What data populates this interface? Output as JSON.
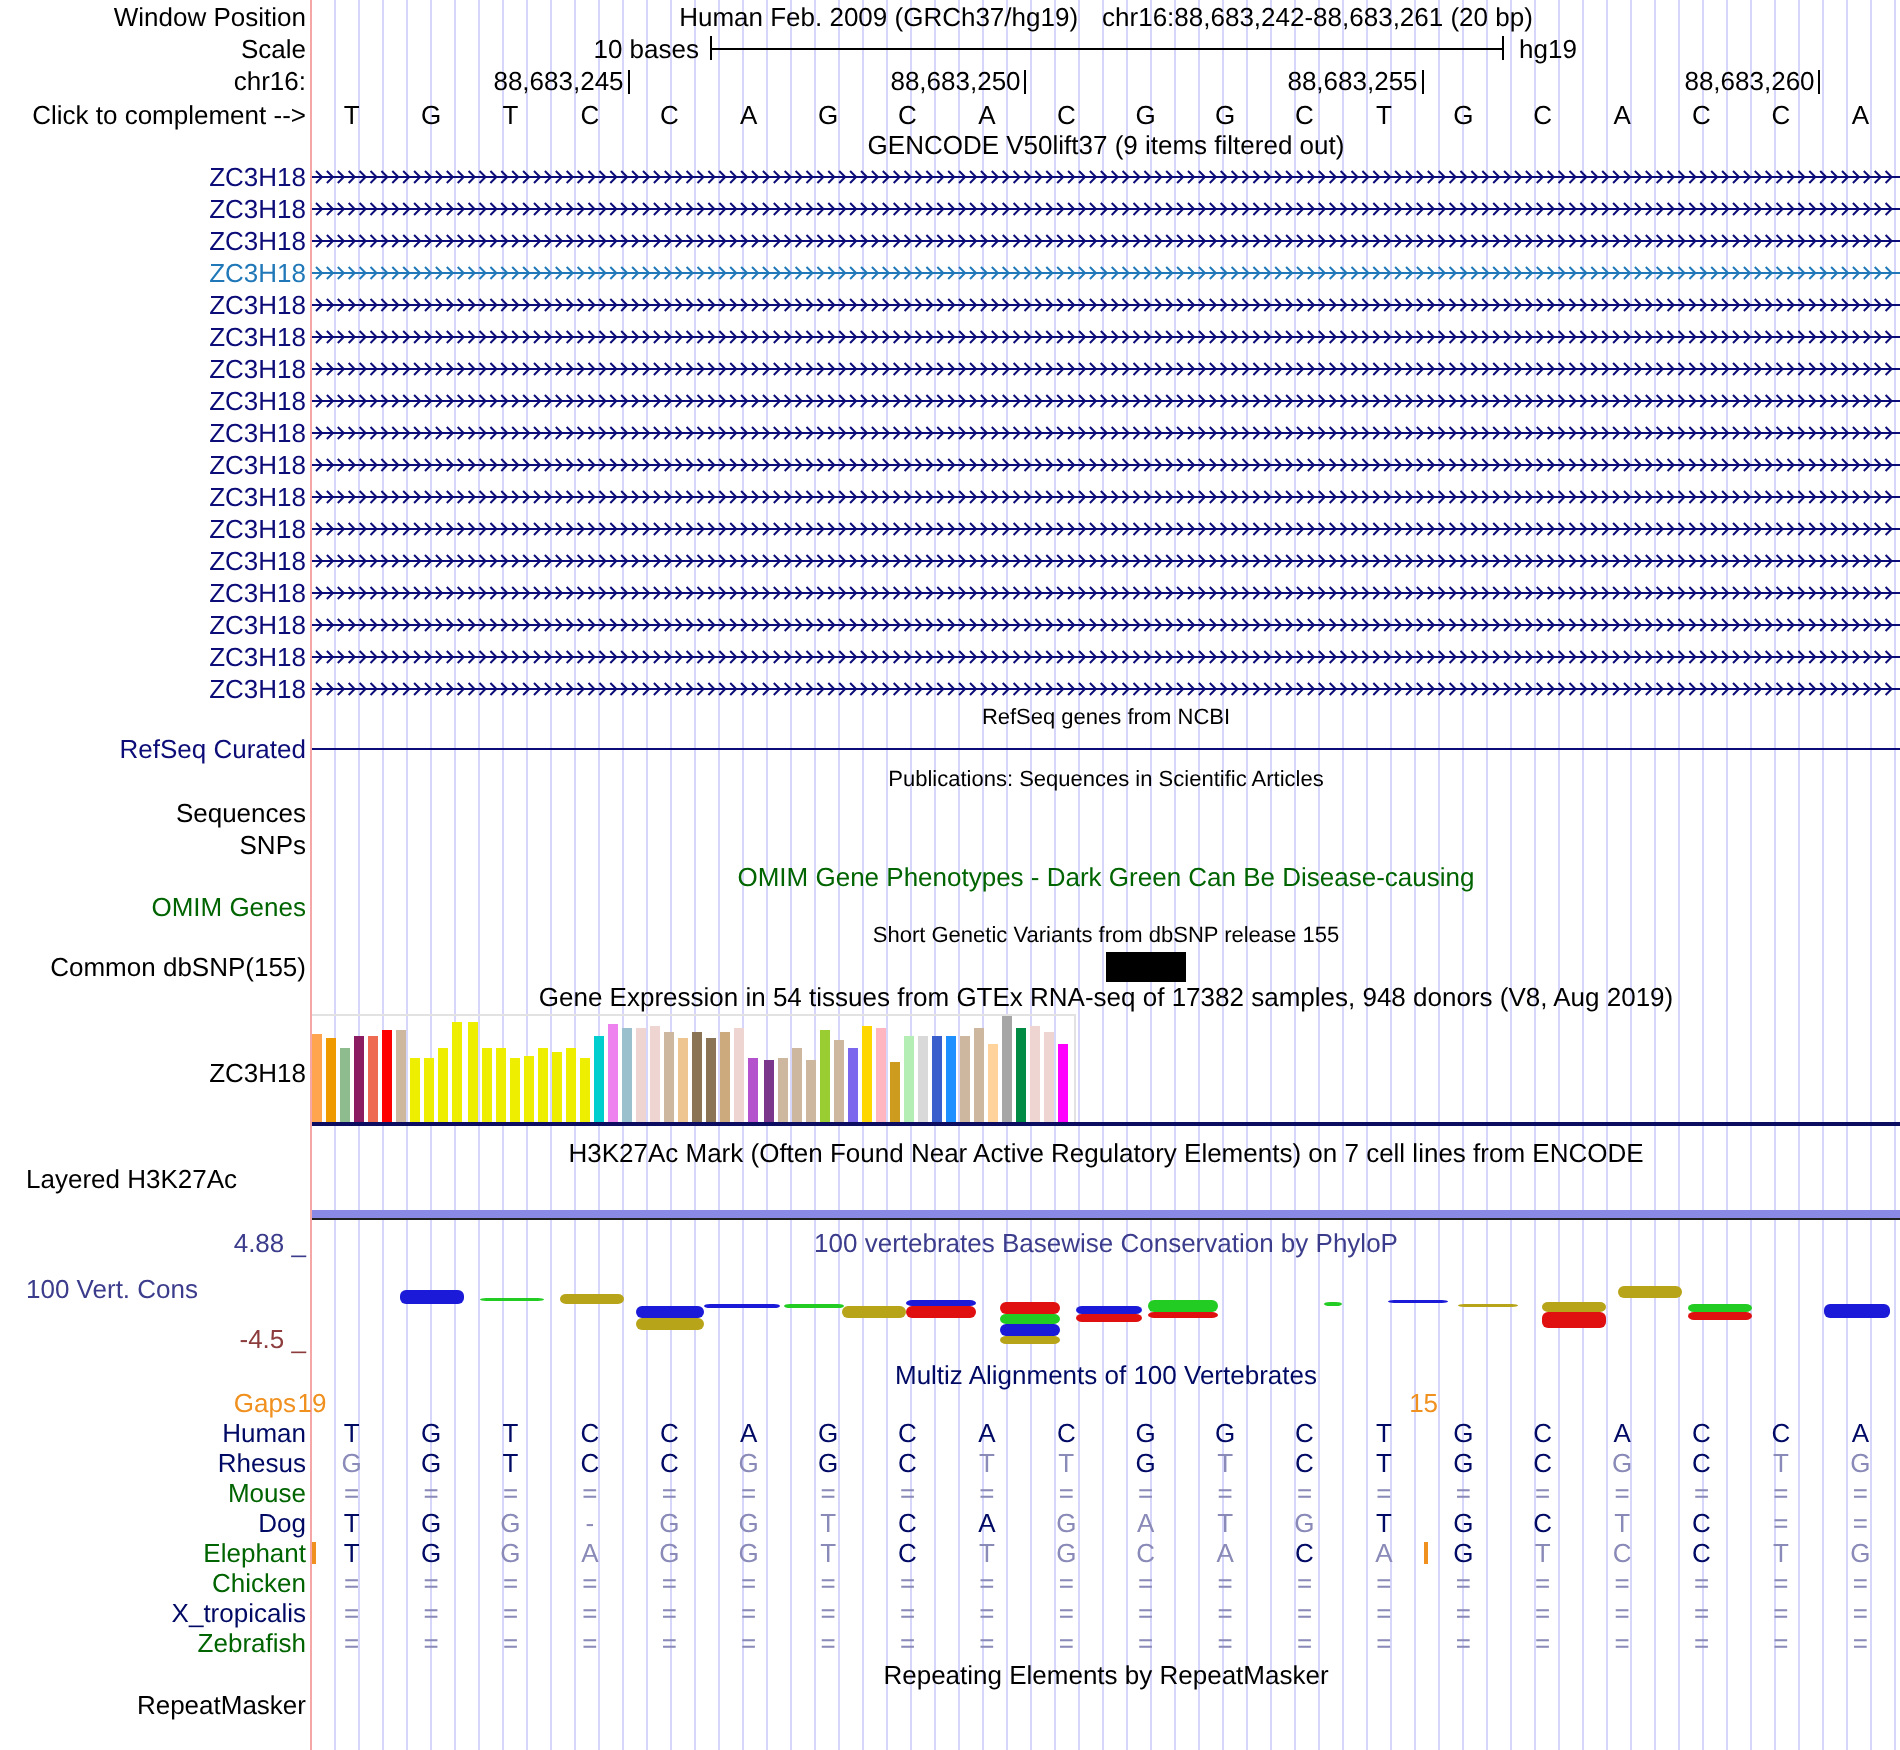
{
  "position": {
    "label": "Window Position",
    "assembly": "Human Feb. 2009 (GRCh37/hg19)",
    "region": "chr16:88,683,242-88,683,261 (20 bp)"
  },
  "scale": {
    "label": "Scale",
    "text": "10 bases",
    "assembly": "hg19"
  },
  "ruler": {
    "label": "chr16:",
    "ticks": [
      "88,683,245",
      "88,683,250",
      "88,683,255",
      "88,683,260"
    ]
  },
  "sequence": {
    "label": "Click to complement -->",
    "bases": [
      "T",
      "G",
      "T",
      "C",
      "C",
      "A",
      "G",
      "C",
      "A",
      "C",
      "G",
      "G",
      "C",
      "T",
      "G",
      "C",
      "A",
      "C",
      "C",
      "A"
    ]
  },
  "tracks": [
    {
      "kind": "genes",
      "title": "GENCODE V50lift37 (9 items filtered out)",
      "color": "#000000",
      "rows": [
        {
          "label": "ZC3H18",
          "color": "#0c0c78"
        },
        {
          "label": "ZC3H18",
          "color": "#0c0c78"
        },
        {
          "label": "ZC3H18",
          "color": "#0c0c78"
        },
        {
          "label": "ZC3H18",
          "color": "#2178b8"
        },
        {
          "label": "ZC3H18",
          "color": "#0c0c78"
        },
        {
          "label": "ZC3H18",
          "color": "#0c0c78"
        },
        {
          "label": "ZC3H18",
          "color": "#0c0c78"
        },
        {
          "label": "ZC3H18",
          "color": "#0c0c78"
        },
        {
          "label": "ZC3H18",
          "color": "#0c0c78"
        },
        {
          "label": "ZC3H18",
          "color": "#0c0c78"
        },
        {
          "label": "ZC3H18",
          "color": "#0c0c78"
        },
        {
          "label": "ZC3H18",
          "color": "#0c0c78"
        },
        {
          "label": "ZC3H18",
          "color": "#0c0c78"
        },
        {
          "label": "ZC3H18",
          "color": "#0c0c78"
        },
        {
          "label": "ZC3H18",
          "color": "#0c0c78"
        },
        {
          "label": "ZC3H18",
          "color": "#0c0c78"
        },
        {
          "label": "ZC3H18",
          "color": "#0c0c78"
        }
      ]
    },
    {
      "kind": "line",
      "title": "RefSeq genes from NCBI",
      "color": "#000000",
      "rows": [
        {
          "label": "RefSeq Curated",
          "color": "#0c0c78"
        }
      ]
    },
    {
      "kind": "labels",
      "title": "Publications: Sequences in Scientific Articles",
      "color": "#000000",
      "rows": [
        {
          "label": "Sequences",
          "color": "#000000"
        },
        {
          "label": "SNPs",
          "color": "#000000"
        }
      ]
    },
    {
      "kind": "empty",
      "title": "OMIM Gene Phenotypes - Dark Green Can Be Disease-causing",
      "color": "#006400",
      "rows": [
        {
          "label": "OMIM Genes",
          "color": "#006400"
        }
      ]
    },
    {
      "kind": "snp",
      "title": "Short Genetic Variants from dbSNP release 155",
      "color": "#000000",
      "rows": [
        {
          "label": "Common dbSNP(155)",
          "color": "#000000",
          "features": [
            {
              "kind": "none"
            },
            {
              "kind": "none"
            },
            {
              "kind": "none"
            },
            {
              "kind": "none"
            },
            {
              "kind": "none"
            },
            {
              "kind": "none"
            },
            {
              "kind": "none"
            },
            {
              "kind": "none"
            },
            {
              "kind": "none"
            },
            {
              "kind": "none"
            },
            {
              "kind": "variant"
            },
            {
              "kind": "none"
            },
            {
              "kind": "none"
            },
            {
              "kind": "none"
            },
            {
              "kind": "none"
            },
            {
              "kind": "none"
            },
            {
              "kind": "none"
            },
            {
              "kind": "none"
            },
            {
              "kind": "none"
            },
            {
              "kind": "none"
            }
          ]
        }
      ]
    },
    {
      "kind": "bars",
      "title": "Gene Expression in 54 tissues from GTEx RNA-seq of 17382 samples, 948 donors (V8, Aug 2019)",
      "color": "#000000",
      "rows": [
        {
          "label": "ZC3H18",
          "color": "#000000",
          "bars": [
            {
              "color": "#ffa54f"
            },
            {
              "color": "#ee9a00"
            },
            {
              "color": "#8fbc8f"
            },
            {
              "color": "#8b1c62"
            },
            {
              "color": "#ee6a50"
            },
            {
              "color": "#ff0000"
            },
            {
              "color": "#cdb79e"
            },
            {
              "color": "#eeee00"
            },
            {
              "color": "#eeee00"
            },
            {
              "color": "#eeee00"
            },
            {
              "color": "#eeee00"
            },
            {
              "color": "#eeee00"
            },
            {
              "color": "#eeee00"
            },
            {
              "color": "#eeee00"
            },
            {
              "color": "#eeee00"
            },
            {
              "color": "#eeee00"
            },
            {
              "color": "#eeee00"
            },
            {
              "color": "#eeee00"
            },
            {
              "color": "#eeee00"
            },
            {
              "color": "#eeee00"
            },
            {
              "color": "#00cdcd"
            },
            {
              "color": "#ee82ee"
            },
            {
              "color": "#9ac0cd"
            },
            {
              "color": "#eed5d2"
            },
            {
              "color": "#eed5d2"
            },
            {
              "color": "#cdb79e"
            },
            {
              "color": "#eec591"
            },
            {
              "color": "#8b7355"
            },
            {
              "color": "#8b7355"
            },
            {
              "color": "#cdaa7d"
            },
            {
              "color": "#eed5d2"
            },
            {
              "color": "#b452cd"
            },
            {
              "color": "#7a378b"
            },
            {
              "color": "#cdb79e"
            },
            {
              "color": "#cdb79e"
            },
            {
              "color": "#cdb79e"
            },
            {
              "color": "#9acd32"
            },
            {
              "color": "#cdb79e"
            },
            {
              "color": "#7a67ee"
            },
            {
              "color": "#ffd700"
            },
            {
              "color": "#ffb6c1"
            },
            {
              "color": "#cd9b1d"
            },
            {
              "color": "#b4eeb4"
            },
            {
              "color": "#d9d9d9"
            },
            {
              "color": "#3a5fcd"
            },
            {
              "color": "#1e90ff"
            },
            {
              "color": "#cdb79e"
            },
            {
              "color": "#cdb79e"
            },
            {
              "color": "#ffd39b"
            },
            {
              "color": "#a6a6a6"
            },
            {
              "color": "#008b45"
            },
            {
              "color": "#eed5d2"
            },
            {
              "color": "#eed5d2"
            },
            {
              "color": "#ff00ff"
            }
          ]
        }
      ]
    },
    {
      "kind": "signal",
      "title": "H3K27Ac Mark (Often Found Near Active Regulatory Elements) on 7 cell lines from ENCODE",
      "color": "#000000",
      "rows": [
        {
          "label": "Layered H3K27Ac",
          "color": "#000000"
        }
      ]
    },
    {
      "kind": "conservation",
      "title": "100 vertebrates Basewise Conservation by PhyloP",
      "color": "#3c3c8c",
      "scale_labels": [
        {
          "text": "4.88 _",
          "color": "#3c3c8c"
        },
        {
          "text": "-4.5 _",
          "color": "#8c3c3c"
        }
      ],
      "rows": [
        {
          "label": "100 Vert. Cons",
          "color": "#3c3c8c"
        }
      ]
    },
    {
      "kind": "alignment",
      "title": "Multiz Alignments of 100 Vertebrates",
      "color": "#000a64",
      "gaps": {
        "label": "Gaps",
        "color": "#f0901e"
      },
      "rows": [
        {
          "label": "Human",
          "color": "#000a64",
          "bases": [
            {
              "base": "T",
              "match": true
            },
            {
              "base": "G",
              "match": true
            },
            {
              "base": "T",
              "match": true
            },
            {
              "base": "C",
              "match": true
            },
            {
              "base": "C",
              "match": true
            },
            {
              "base": "A",
              "match": true
            },
            {
              "base": "G",
              "match": true
            },
            {
              "base": "C",
              "match": true
            },
            {
              "base": "A",
              "match": true
            },
            {
              "base": "C",
              "match": true
            },
            {
              "base": "G",
              "match": true
            },
            {
              "base": "G",
              "match": true
            },
            {
              "base": "C",
              "match": true
            },
            {
              "base": "T",
              "match": true
            },
            {
              "base": "G",
              "match": true
            },
            {
              "base": "C",
              "match": true
            },
            {
              "base": "A",
              "match": true
            },
            {
              "base": "C",
              "match": true
            },
            {
              "base": "C",
              "match": true
            },
            {
              "base": "A",
              "match": true
            }
          ]
        },
        {
          "label": "Rhesus",
          "color": "#000a64",
          "bases": [
            {
              "base": "G",
              "match": false
            },
            {
              "base": "G",
              "match": true
            },
            {
              "base": "T",
              "match": true
            },
            {
              "base": "C",
              "match": true
            },
            {
              "base": "C",
              "match": true
            },
            {
              "base": "G",
              "match": false
            },
            {
              "base": "G",
              "match": true
            },
            {
              "base": "C",
              "match": true
            },
            {
              "base": "T",
              "match": false
            },
            {
              "base": "T",
              "match": false
            },
            {
              "base": "G",
              "match": true
            },
            {
              "base": "T",
              "match": false
            },
            {
              "base": "C",
              "match": true
            },
            {
              "base": "T",
              "match": true
            },
            {
              "base": "G",
              "match": true
            },
            {
              "base": "C",
              "match": true
            },
            {
              "base": "G",
              "match": false
            },
            {
              "base": "C",
              "match": true
            },
            {
              "base": "T",
              "match": false
            },
            {
              "base": "G",
              "match": false
            }
          ]
        },
        {
          "label": "Mouse",
          "color": "#006400",
          "bases": [
            {
              "base": "=",
              "match": false
            },
            {
              "base": "=",
              "match": false
            },
            {
              "base": "=",
              "match": false
            },
            {
              "base": "=",
              "match": false
            },
            {
              "base": "=",
              "match": false
            },
            {
              "base": "=",
              "match": false
            },
            {
              "base": "=",
              "match": false
            },
            {
              "base": "=",
              "match": false
            },
            {
              "base": "=",
              "match": false
            },
            {
              "base": "=",
              "match": false
            },
            {
              "base": "=",
              "match": false
            },
            {
              "base": "=",
              "match": false
            },
            {
              "base": "=",
              "match": false
            },
            {
              "base": "=",
              "match": false
            },
            {
              "base": "=",
              "match": false
            },
            {
              "base": "=",
              "match": false
            },
            {
              "base": "=",
              "match": false
            },
            {
              "base": "=",
              "match": false
            },
            {
              "base": "=",
              "match": false
            },
            {
              "base": "=",
              "match": false
            }
          ]
        },
        {
          "label": "Dog",
          "color": "#000a64",
          "bases": [
            {
              "base": "T",
              "match": true
            },
            {
              "base": "G",
              "match": true
            },
            {
              "base": "G",
              "match": false
            },
            {
              "base": "-",
              "match": false
            },
            {
              "base": "G",
              "match": false
            },
            {
              "base": "G",
              "match": false
            },
            {
              "base": "T",
              "match": false
            },
            {
              "base": "C",
              "match": true
            },
            {
              "base": "A",
              "match": true
            },
            {
              "base": "G",
              "match": false
            },
            {
              "base": "A",
              "match": false
            },
            {
              "base": "T",
              "match": false
            },
            {
              "base": "G",
              "match": false
            },
            {
              "base": "T",
              "match": true
            },
            {
              "base": "G",
              "match": true
            },
            {
              "base": "C",
              "match": true
            },
            {
              "base": "T",
              "match": false
            },
            {
              "base": "C",
              "match": true
            },
            {
              "base": "=",
              "match": false
            },
            {
              "base": "=",
              "match": false
            }
          ]
        },
        {
          "label": "Elephant",
          "color": "#006400",
          "bases": [
            {
              "base": "T",
              "match": true,
              "insert": true,
              "gap_count": "19"
            },
            {
              "base": "G",
              "match": true,
              "insert": false
            },
            {
              "base": "G",
              "match": false,
              "insert": false
            },
            {
              "base": "A",
              "match": false,
              "insert": false
            },
            {
              "base": "G",
              "match": false,
              "insert": false
            },
            {
              "base": "G",
              "match": false,
              "insert": false
            },
            {
              "base": "T",
              "match": false,
              "insert": false
            },
            {
              "base": "C",
              "match": true,
              "insert": false
            },
            {
              "base": "T",
              "match": false,
              "insert": false
            },
            {
              "base": "G",
              "match": false,
              "insert": false
            },
            {
              "base": "C",
              "match": false,
              "insert": false
            },
            {
              "base": "A",
              "match": false,
              "insert": false
            },
            {
              "base": "C",
              "match": true,
              "insert": false
            },
            {
              "base": "A",
              "match": false,
              "insert": false
            },
            {
              "base": "G",
              "match": true,
              "insert": true,
              "gap_count": "15"
            },
            {
              "base": "T",
              "match": false,
              "insert": false
            },
            {
              "base": "C",
              "match": false,
              "insert": false
            },
            {
              "base": "C",
              "match": true,
              "insert": false
            },
            {
              "base": "T",
              "match": false,
              "insert": false
            },
            {
              "base": "G",
              "match": false,
              "insert": false
            }
          ]
        },
        {
          "label": "Chicken",
          "color": "#006400",
          "bases": [
            {
              "base": "=",
              "match": false
            },
            {
              "base": "=",
              "match": false
            },
            {
              "base": "=",
              "match": false
            },
            {
              "base": "=",
              "match": false
            },
            {
              "base": "=",
              "match": false
            },
            {
              "base": "=",
              "match": false
            },
            {
              "base": "=",
              "match": false
            },
            {
              "base": "=",
              "match": false
            },
            {
              "base": "=",
              "match": false
            },
            {
              "base": "=",
              "match": false
            },
            {
              "base": "=",
              "match": false
            },
            {
              "base": "=",
              "match": false
            },
            {
              "base": "=",
              "match": false
            },
            {
              "base": "=",
              "match": false
            },
            {
              "base": "=",
              "match": false
            },
            {
              "base": "=",
              "match": false
            },
            {
              "base": "=",
              "match": false
            },
            {
              "base": "=",
              "match": false
            },
            {
              "base": "=",
              "match": false
            },
            {
              "base": "=",
              "match": false
            }
          ]
        },
        {
          "label": "X_tropicalis",
          "color": "#000a64",
          "bases": [
            {
              "base": "=",
              "match": false
            },
            {
              "base": "=",
              "match": false
            },
            {
              "base": "=",
              "match": false
            },
            {
              "base": "=",
              "match": false
            },
            {
              "base": "=",
              "match": false
            },
            {
              "base": "=",
              "match": false
            },
            {
              "base": "=",
              "match": false
            },
            {
              "base": "=",
              "match": false
            },
            {
              "base": "=",
              "match": false
            },
            {
              "base": "=",
              "match": false
            },
            {
              "base": "=",
              "match": false
            },
            {
              "base": "=",
              "match": false
            },
            {
              "base": "=",
              "match": false
            },
            {
              "base": "=",
              "match": false
            },
            {
              "base": "=",
              "match": false
            },
            {
              "base": "=",
              "match": false
            },
            {
              "base": "=",
              "match": false
            },
            {
              "base": "=",
              "match": false
            },
            {
              "base": "=",
              "match": false
            },
            {
              "base": "=",
              "match": false
            }
          ]
        },
        {
          "label": "Zebrafish",
          "color": "#006400",
          "bases": [
            {
              "base": "=",
              "match": false
            },
            {
              "base": "=",
              "match": false
            },
            {
              "base": "=",
              "match": false
            },
            {
              "base": "=",
              "match": false
            },
            {
              "base": "=",
              "match": false
            },
            {
              "base": "=",
              "match": false
            },
            {
              "base": "=",
              "match": false
            },
            {
              "base": "=",
              "match": false
            },
            {
              "base": "=",
              "match": false
            },
            {
              "base": "=",
              "match": false
            },
            {
              "base": "=",
              "match": false
            },
            {
              "base": "=",
              "match": false
            },
            {
              "base": "=",
              "match": false
            },
            {
              "base": "=",
              "match": false
            },
            {
              "base": "=",
              "match": false
            },
            {
              "base": "=",
              "match": false
            },
            {
              "base": "=",
              "match": false
            },
            {
              "base": "=",
              "match": false
            },
            {
              "base": "=",
              "match": false
            },
            {
              "base": "=",
              "match": false
            }
          ]
        }
      ]
    },
    {
      "kind": "empty",
      "title": "Repeating Elements by RepeatMasker",
      "color": "#000000",
      "rows": [
        {
          "label": "RepeatMasker",
          "color": "#000000"
        }
      ]
    }
  ]
}
